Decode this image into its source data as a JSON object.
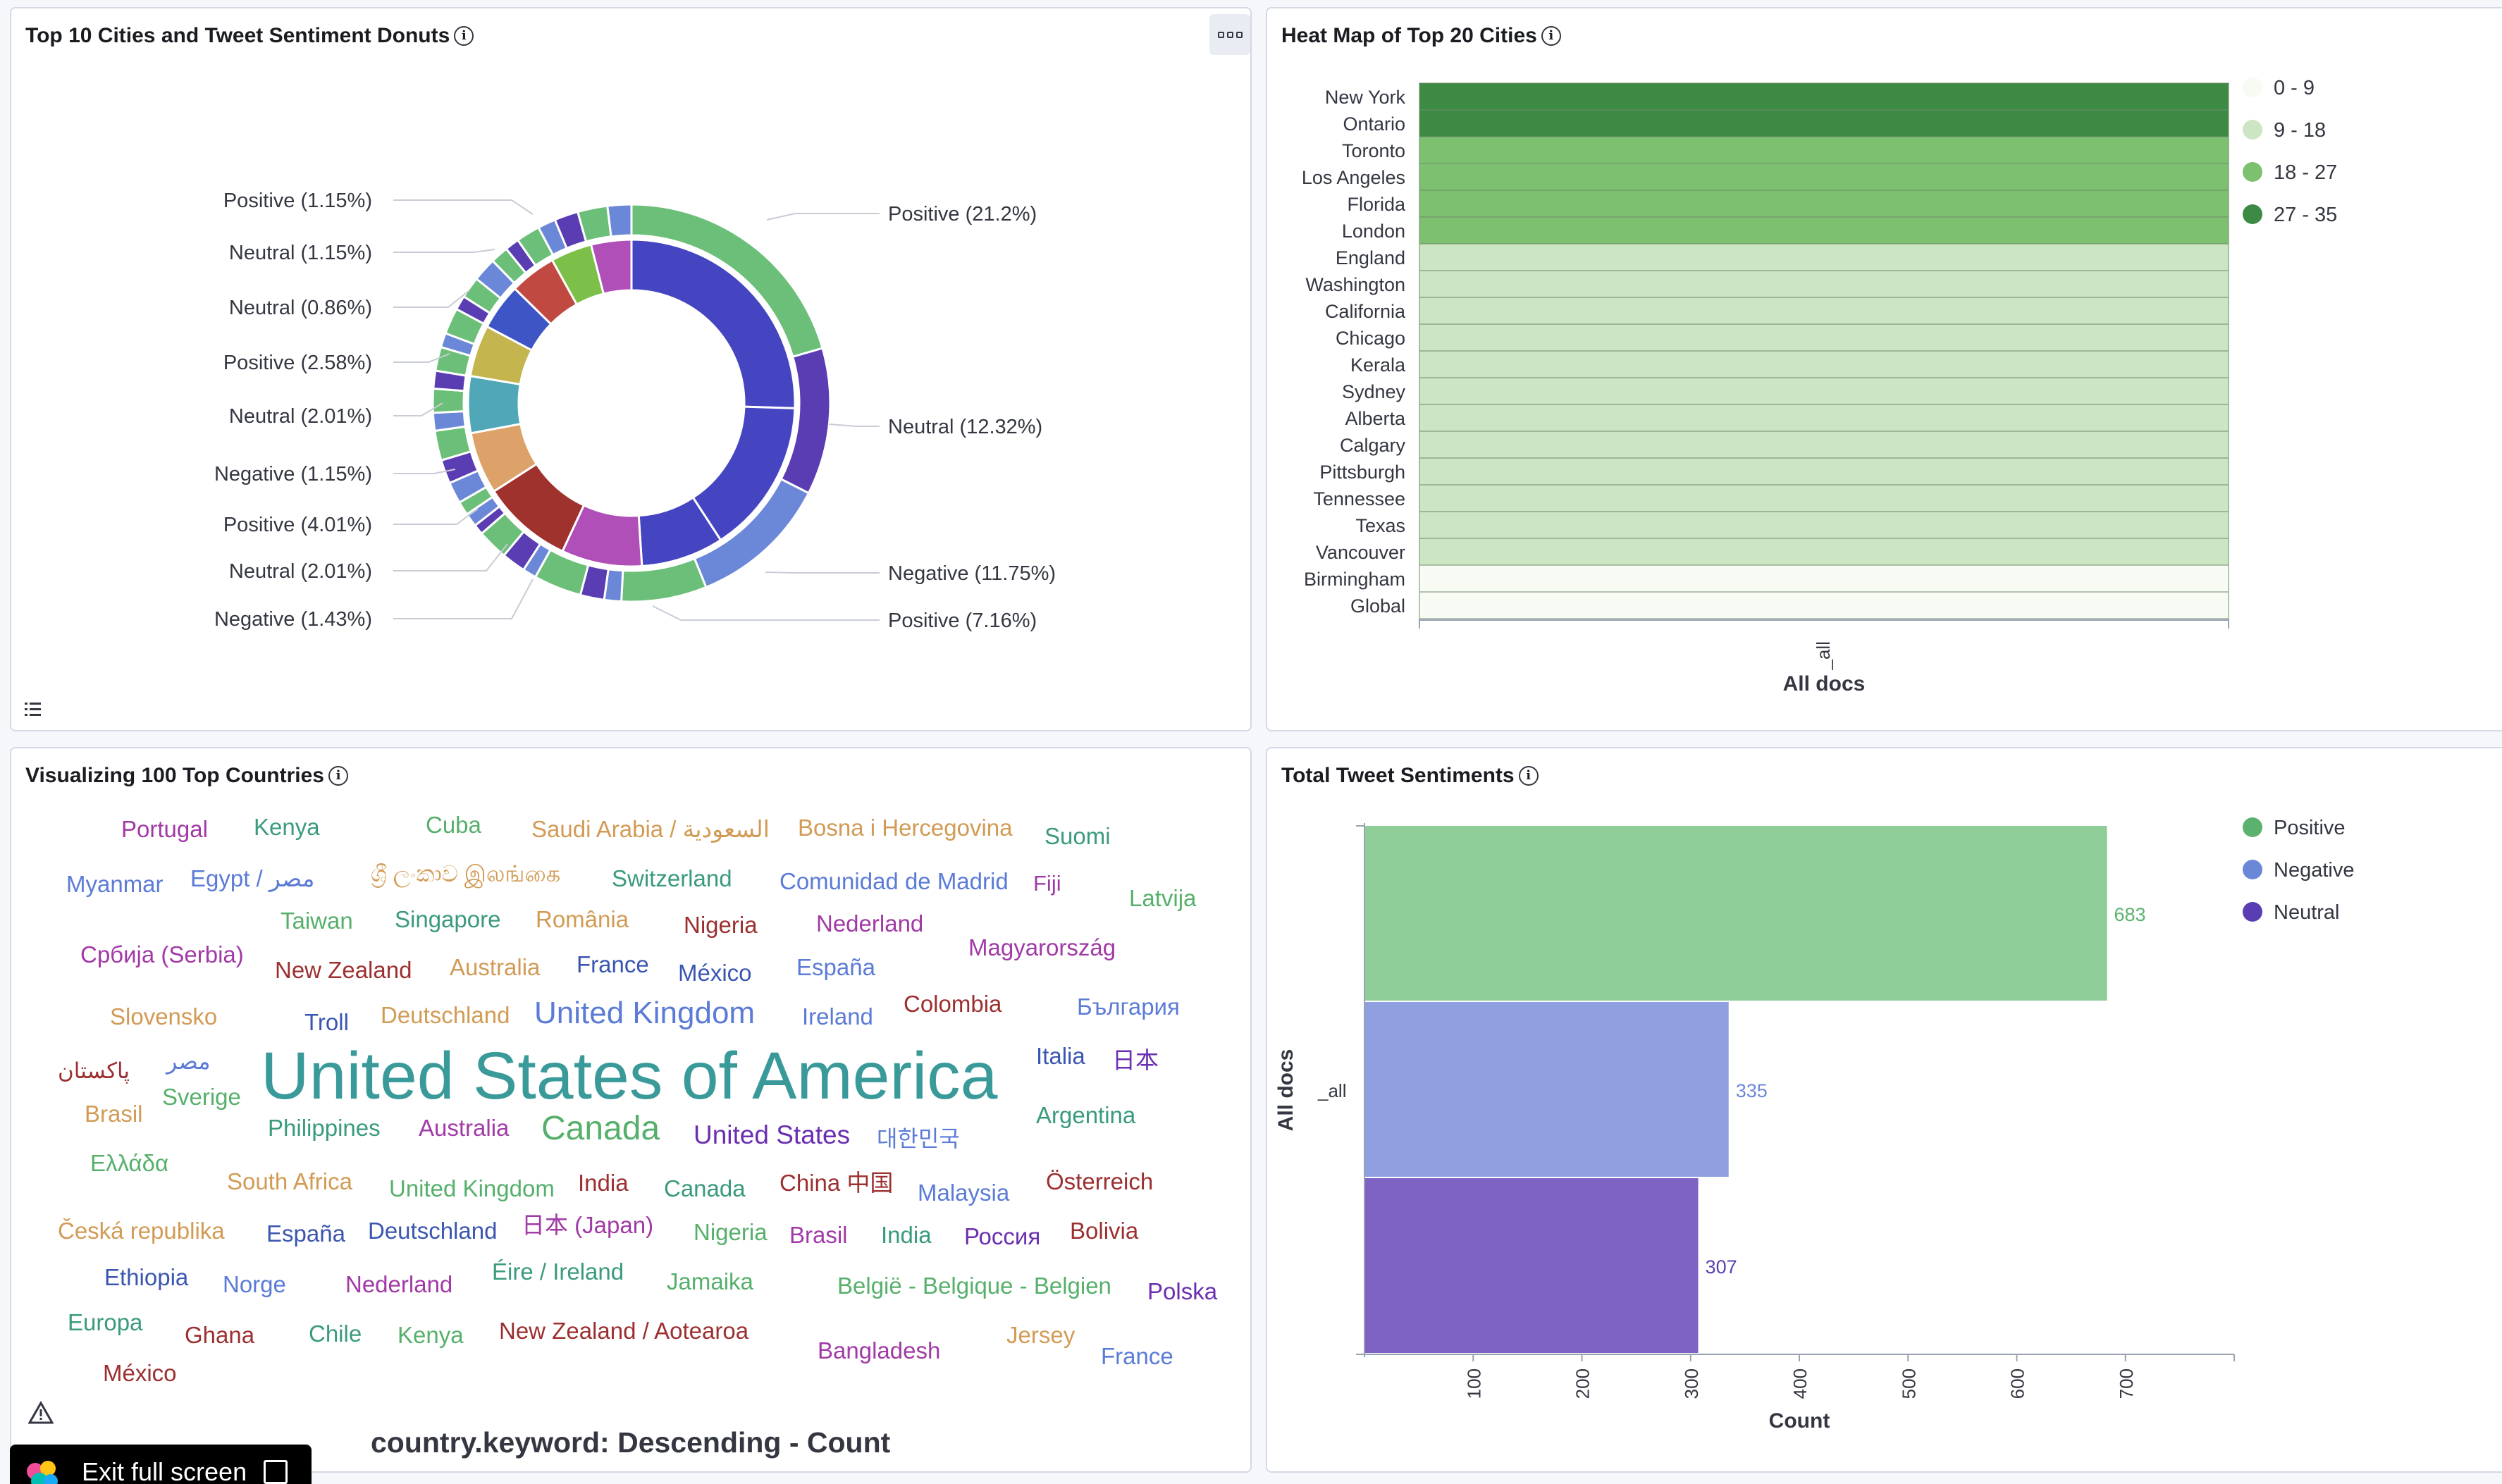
{
  "donut_panel": {
    "title": "Top 10 Cities and Tweet Sentiment Donuts",
    "left_labels": [
      "Positive (1.15%)",
      "Neutral (1.15%)",
      "Neutral (0.86%)",
      "Positive (2.58%)",
      "Neutral (2.01%)",
      "Negative (1.15%)",
      "Positive (4.01%)",
      "Neutral (2.01%)",
      "Negative (1.43%)"
    ],
    "right_labels": [
      "Positive (21.2%)",
      "Neutral (12.32%)",
      "Negative (11.75%)",
      "Positive (7.16%)"
    ],
    "icons": [
      "legend-list-icon",
      "panel-options-icon",
      "info-icon"
    ]
  },
  "heatmap_panel": {
    "title": "Heat Map of Top 20 Cities",
    "cities": [
      "New York",
      "Ontario",
      "Toronto",
      "Los Angeles",
      "Florida",
      "London",
      "England",
      "Washington",
      "California",
      "Chicago",
      "Kerala",
      "Sydney",
      "Alberta",
      "Calgary",
      "Pittsburgh",
      "Tennessee",
      "Texas",
      "Vancouver",
      "Birmingham",
      "Global"
    ],
    "city_bucket": [
      3,
      3,
      2,
      2,
      2,
      2,
      1,
      1,
      1,
      1,
      1,
      1,
      1,
      1,
      1,
      1,
      1,
      1,
      0,
      0
    ],
    "legend": [
      {
        "label": "0 - 9",
        "color": "#f7fbf4"
      },
      {
        "label": "9 - 18",
        "color": "#cce5c2"
      },
      {
        "label": "18 - 27",
        "color": "#7cc070"
      },
      {
        "label": "27 - 35",
        "color": "#3d8a45"
      }
    ],
    "x_tick": "_all",
    "x_label": "All docs"
  },
  "wordcloud_panel": {
    "title": "Visualizing 100 Top Countries",
    "caption": "country.keyword: Descending - Count",
    "words": [
      {
        "t": "Portugal",
        "c": "#a13aa6"
      },
      {
        "t": "Kenya",
        "c": "#3a9a7e"
      },
      {
        "t": "Cuba",
        "c": "#56b06b"
      },
      {
        "t": "Saudi Arabia / السعودية",
        "c": "#d29b55"
      },
      {
        "t": "Bosna i Hercegovina",
        "c": "#d29b55"
      },
      {
        "t": "Suomi",
        "c": "#3a9a7e"
      },
      {
        "t": "Myanmar",
        "c": "#5b7bd6"
      },
      {
        "t": "Egypt / مصر",
        "c": "#5b7bd6"
      },
      {
        "t": "ශ්‍රී ලංකාව இலங்கை",
        "c": "#d29b55"
      },
      {
        "t": "Switzerland",
        "c": "#3a9a7e"
      },
      {
        "t": "Comunidad de Madrid",
        "c": "#5b7bd6"
      },
      {
        "t": "Fiji",
        "c": "#a13aa6"
      },
      {
        "t": "Latvija",
        "c": "#56b06b"
      },
      {
        "t": "Taiwan",
        "c": "#56b06b"
      },
      {
        "t": "Singapore",
        "c": "#3a9a7e"
      },
      {
        "t": "România",
        "c": "#d29b55"
      },
      {
        "t": "Nigeria",
        "c": "#9c2f2f"
      },
      {
        "t": "Nederland",
        "c": "#a13aa6"
      },
      {
        "t": "Србија (Serbia)",
        "c": "#a13aa6"
      },
      {
        "t": "Magyarország",
        "c": "#a13aa6"
      },
      {
        "t": "New Zealand",
        "c": "#9c2f2f"
      },
      {
        "t": "Australia",
        "c": "#d29b55"
      },
      {
        "t": "France",
        "c": "#3a56b0"
      },
      {
        "t": "México",
        "c": "#3a56b0"
      },
      {
        "t": "España",
        "c": "#5b7bd6"
      },
      {
        "t": "Slovensko",
        "c": "#d29b55"
      },
      {
        "t": "Troll",
        "c": "#3a56b0"
      },
      {
        "t": "Deutschland",
        "c": "#d29b55"
      },
      {
        "t": "United Kingdom",
        "c": "#5b7bd6"
      },
      {
        "t": "Ireland",
        "c": "#5b7bd6"
      },
      {
        "t": "Colombia",
        "c": "#9c2f2f"
      },
      {
        "t": "България",
        "c": "#5b7bd6"
      },
      {
        "t": "پاکستان",
        "c": "#9c2f2f"
      },
      {
        "t": "مصر",
        "c": "#5b7bd6"
      },
      {
        "t": "United States of America",
        "c": "#3a9a9a"
      },
      {
        "t": "Italia",
        "c": "#3a56b0"
      },
      {
        "t": "日本",
        "c": "#6a2fb0"
      },
      {
        "t": "Sverige",
        "c": "#56b06b"
      },
      {
        "t": "Brasil",
        "c": "#d29b55"
      },
      {
        "t": "Philippines",
        "c": "#3a9a7e"
      },
      {
        "t": "Australia",
        "c": "#a13aa6"
      },
      {
        "t": "Canada",
        "c": "#56b06b"
      },
      {
        "t": "United States",
        "c": "#6a2fb0"
      },
      {
        "t": "대한민국",
        "c": "#5b7bd6"
      },
      {
        "t": "Argentina",
        "c": "#3a9a7e"
      },
      {
        "t": "Ελλάδα",
        "c": "#56b06b"
      },
      {
        "t": "South Africa",
        "c": "#d29b55"
      },
      {
        "t": "United Kingdom",
        "c": "#56b06b"
      },
      {
        "t": "India",
        "c": "#9c2f2f"
      },
      {
        "t": "Canada",
        "c": "#3a9a7e"
      },
      {
        "t": "China 中国",
        "c": "#9c2f2f"
      },
      {
        "t": "Malaysia",
        "c": "#5b7bd6"
      },
      {
        "t": "Österreich",
        "c": "#9c2f2f"
      },
      {
        "t": "Česká republika",
        "c": "#d29b55"
      },
      {
        "t": "España",
        "c": "#3a56b0"
      },
      {
        "t": "Deutschland",
        "c": "#3a56b0"
      },
      {
        "t": "日本 (Japan)",
        "c": "#a13aa6"
      },
      {
        "t": "Nigeria",
        "c": "#56b06b"
      },
      {
        "t": "Brasil",
        "c": "#a13aa6"
      },
      {
        "t": "India",
        "c": "#3a9a7e"
      },
      {
        "t": "Россия",
        "c": "#6a2fb0"
      },
      {
        "t": "Bolivia",
        "c": "#9c2f2f"
      },
      {
        "t": "Ethiopia",
        "c": "#3a56b0"
      },
      {
        "t": "Norge",
        "c": "#5b7bd6"
      },
      {
        "t": "Nederland",
        "c": "#a13aa6"
      },
      {
        "t": "Éire / Ireland",
        "c": "#3a9a7e"
      },
      {
        "t": "Jamaika",
        "c": "#56b06b"
      },
      {
        "t": "België - Belgique - Belgien",
        "c": "#56b06b"
      },
      {
        "t": "Polska",
        "c": "#6a2fb0"
      },
      {
        "t": "Europa",
        "c": "#3a9a7e"
      },
      {
        "t": "Ghana",
        "c": "#9c2f2f"
      },
      {
        "t": "Chile",
        "c": "#3a9a7e"
      },
      {
        "t": "Kenya",
        "c": "#56b06b"
      },
      {
        "t": "New Zealand / Aotearoa",
        "c": "#9c2f2f"
      },
      {
        "t": "Bangladesh",
        "c": "#a13aa6"
      },
      {
        "t": "Jersey",
        "c": "#d29b55"
      },
      {
        "t": "France",
        "c": "#5b7bd6"
      },
      {
        "t": "México",
        "c": "#9c2f2f"
      }
    ]
  },
  "bar_panel": {
    "title": "Total Tweet Sentiments",
    "legend": [
      {
        "label": "Positive",
        "color": "#5ab26e"
      },
      {
        "label": "Negative",
        "color": "#6b88d8"
      },
      {
        "label": "Neutral",
        "color": "#5a3db3"
      }
    ],
    "y_tick": "_all",
    "y_label": "All docs",
    "x_label": "Count",
    "x_ticks": [
      "100",
      "200",
      "300",
      "400",
      "500",
      "600",
      "700"
    ]
  },
  "chart_data": {
    "type": "bar",
    "orientation": "horizontal",
    "categories": [
      "Positive",
      "Negative",
      "Neutral"
    ],
    "values": [
      683,
      335,
      307
    ],
    "xlabel": "Count",
    "ylabel": "All docs",
    "xlim": [
      0,
      800
    ]
  },
  "exit_button": {
    "label": "Exit full screen"
  },
  "colors": {
    "accent": "#006bb4",
    "border": "#d3dae6",
    "background": "#f5f7fa"
  }
}
